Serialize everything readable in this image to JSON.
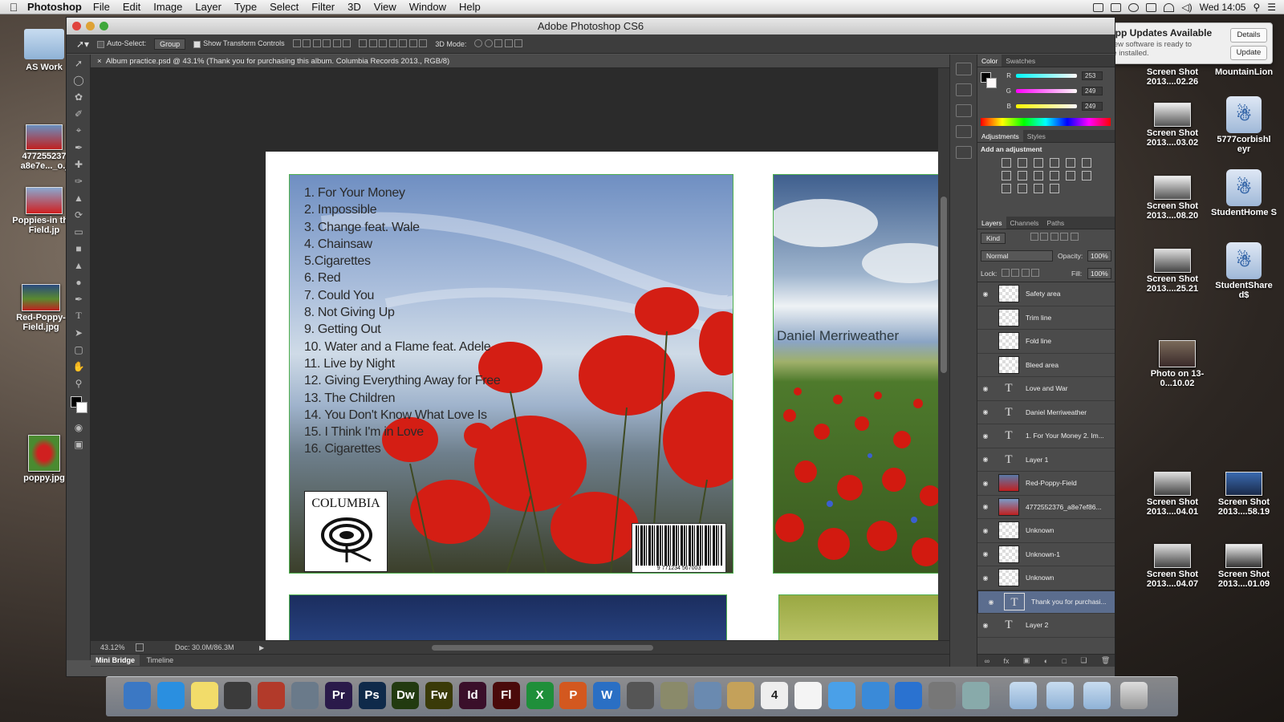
{
  "menubar": {
    "app": "Photoshop",
    "items": [
      "File",
      "Edit",
      "Image",
      "Layer",
      "Type",
      "Select",
      "Filter",
      "3D",
      "View",
      "Window",
      "Help"
    ],
    "clock": "Wed 14:05"
  },
  "window": {
    "title": "Adobe Photoshop CS6"
  },
  "options": {
    "auto_select": "Auto-Select:",
    "group": "Group",
    "show_transform": "Show Transform Controls",
    "mode_3d": "3D Mode:"
  },
  "doc": {
    "tab": "Album practice.psd @ 43.1% (Thank you for purchasing this album. Columbia Records 2013., RGB/8)",
    "zoom": "43.12%",
    "size": "Doc: 30.0M/86.3M"
  },
  "bottom_tabs": [
    "Mini Bridge",
    "Timeline"
  ],
  "album": {
    "tracks": [
      "1. For Your Money",
      "2. Impossible",
      "3. Change feat. Wale",
      "4. Chainsaw",
      "5.Cigarettes",
      "6. Red",
      "7. Could You",
      "8. Not Giving Up",
      "9. Getting Out",
      "10. Water and a Flame feat. Adele",
      "11. Live by Night",
      "12. Giving Everything Away for Free",
      "13. The Children",
      "14. You Don't Know What Love Is",
      "15. I Think I'm in Love",
      "16. Cigarettes"
    ],
    "label": "COLUMBIA",
    "barcode": "9   771234   567003",
    "artist": "Daniel Merriweather"
  },
  "color_panel": {
    "tabs": [
      "Color",
      "Swatches"
    ],
    "r": "253",
    "g": "249",
    "b": "249",
    "r_label": "R",
    "g_label": "G",
    "b_label": "B"
  },
  "adjust_panel": {
    "tabs": [
      "Adjustments",
      "Styles"
    ],
    "heading": "Add an adjustment"
  },
  "layers_panel": {
    "tabs": [
      "Layers",
      "Channels",
      "Paths"
    ],
    "kind": "Kind",
    "blend": "Normal",
    "opacity_label": "Opacity:",
    "opacity": "100%",
    "lock": "Lock:",
    "fill_label": "Fill:",
    "fill": "100%",
    "layers": [
      {
        "name": "Safety area",
        "type": "raster",
        "visible": true
      },
      {
        "name": "Trim line",
        "type": "raster",
        "visible": false
      },
      {
        "name": "Fold line",
        "type": "raster",
        "visible": false
      },
      {
        "name": "Bleed area",
        "type": "raster",
        "visible": false
      },
      {
        "name": "Love and War",
        "type": "text",
        "visible": true
      },
      {
        "name": "Daniel Merriweather",
        "type": "text",
        "visible": true
      },
      {
        "name": "1. For Your Money 2. Im...",
        "type": "text",
        "visible": true
      },
      {
        "name": "Layer 1",
        "type": "text",
        "visible": true
      },
      {
        "name": "Red-Poppy-Field",
        "type": "smart",
        "visible": true
      },
      {
        "name": "4772552376_a8e7ef86...",
        "type": "smart",
        "visible": true
      },
      {
        "name": "Unknown",
        "type": "raster",
        "visible": true
      },
      {
        "name": "Unknown-1",
        "type": "raster",
        "visible": true
      },
      {
        "name": "Unknown",
        "type": "raster",
        "visible": true
      },
      {
        "name": "Thank you for purchasi...",
        "type": "text",
        "visible": true,
        "selected": true
      },
      {
        "name": "Layer 2",
        "type": "text",
        "visible": true
      }
    ]
  },
  "notification": {
    "title": "App Updates Available",
    "body": "New software is ready to be installed.",
    "details": "Details",
    "update": "Update"
  },
  "desktop_left": [
    {
      "label": "AS Work",
      "kind": "folder"
    },
    {
      "label": "477255237 a8e7e..._o.j",
      "kind": "image"
    },
    {
      "label": "Poppies-in the-Field.jp",
      "kind": "image"
    },
    {
      "label": "Red-Poppy-Field.jpg",
      "kind": "image"
    },
    {
      "label": "poppy.jpg",
      "kind": "image"
    }
  ],
  "desktop_right": [
    {
      "label": "Screen Shot 2013....02.26",
      "kind": "shot"
    },
    {
      "label": "MountainLion",
      "kind": "drive"
    },
    {
      "label": "Screen Shot 2013....03.02",
      "kind": "shot"
    },
    {
      "label": "5777corbishl eyr",
      "kind": "users"
    },
    {
      "label": "Screen Shot 2013....08.20",
      "kind": "shot"
    },
    {
      "label": "StudentHome S",
      "kind": "users"
    },
    {
      "label": "Screen Shot 2013....25.21",
      "kind": "shot"
    },
    {
      "label": "StudentShare d$",
      "kind": "users"
    },
    {
      "label": "Photo on 13-0...10.02",
      "kind": "photo"
    },
    {
      "label": "Screen Shot 2013....04.01",
      "kind": "shot"
    },
    {
      "label": "Screen Shot 2013....58.19",
      "kind": "shot"
    },
    {
      "label": "Screen Shot 2013....04.07",
      "kind": "shot"
    },
    {
      "label": "Screen Shot 2013....01.09",
      "kind": "shot"
    }
  ],
  "dock": [
    {
      "label": "",
      "color": "#3b78c4",
      "name": "finder"
    },
    {
      "label": "",
      "color": "#2a8fe0",
      "name": "safari"
    },
    {
      "label": "",
      "color": "#f2dc6a",
      "name": "stickies"
    },
    {
      "label": "",
      "color": "#3b3b3b",
      "name": "facetime"
    },
    {
      "label": "",
      "color": "#b23a2a",
      "name": "photo-booth"
    },
    {
      "label": "",
      "color": "#6a7a8a",
      "name": "iphoto"
    },
    {
      "label": "Pr",
      "color": "#2a1a4a",
      "name": "premiere"
    },
    {
      "label": "Ps",
      "color": "#0f2a4a",
      "name": "photoshop"
    },
    {
      "label": "Dw",
      "color": "#223a10",
      "name": "dreamweaver"
    },
    {
      "label": "Fw",
      "color": "#3a3a08",
      "name": "fireworks"
    },
    {
      "label": "Id",
      "color": "#3a0f2a",
      "name": "indesign"
    },
    {
      "label": "Fl",
      "color": "#4a0a0a",
      "name": "flash"
    },
    {
      "label": "X",
      "color": "#1f8f3a",
      "name": "excel"
    },
    {
      "label": "P",
      "color": "#d3581f",
      "name": "powerpoint"
    },
    {
      "label": "W",
      "color": "#2a6fc4",
      "name": "word"
    },
    {
      "label": "",
      "color": "#555",
      "name": "launchpad"
    },
    {
      "label": "",
      "color": "#8a8a6a",
      "name": "preview"
    },
    {
      "label": "",
      "color": "#6a8ab0",
      "name": "mail"
    },
    {
      "label": "",
      "color": "#c4a15a",
      "name": "contacts"
    },
    {
      "label": "4",
      "color": "#eee",
      "name": "calendar"
    },
    {
      "label": "",
      "color": "#f4f4f4",
      "name": "reminders"
    },
    {
      "label": "",
      "color": "#4aa0e8",
      "name": "messages"
    },
    {
      "label": "",
      "color": "#3a8ad8",
      "name": "itunes"
    },
    {
      "label": "",
      "color": "#2a72d0",
      "name": "app-store"
    },
    {
      "label": "",
      "color": "#777",
      "name": "system-preferences"
    },
    {
      "label": "",
      "color": "#8aa",
      "name": "photos"
    }
  ]
}
